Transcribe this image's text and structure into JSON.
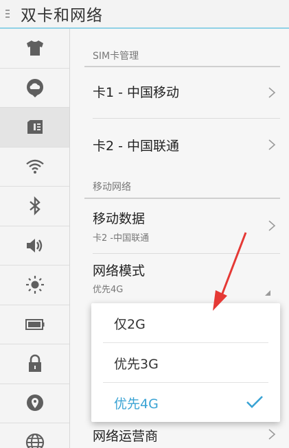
{
  "title": "双卡和网络",
  "sidebar": {
    "items": [
      {
        "icon": "shirt-icon"
      },
      {
        "icon": "cloud-icon"
      },
      {
        "icon": "sim-card-icon",
        "active": true
      },
      {
        "icon": "wifi-icon"
      },
      {
        "icon": "bluetooth-icon"
      },
      {
        "icon": "volume-icon"
      },
      {
        "icon": "brightness-icon"
      },
      {
        "icon": "battery-icon"
      },
      {
        "icon": "lock-icon"
      },
      {
        "icon": "location-icon"
      },
      {
        "icon": "globe-icon"
      }
    ]
  },
  "sim_section": {
    "header": "SIM卡管理",
    "card1": "卡1 - 中国移动",
    "card2": "卡2 - 中国联通"
  },
  "mobile_section": {
    "header": "移动网络",
    "mobile_data": {
      "title": "移动数据",
      "subtitle": "卡2 -中国联通"
    },
    "network_mode": {
      "title": "网络模式",
      "subtitle": "优先4G"
    },
    "operator": {
      "title": "网络运营商"
    }
  },
  "dropdown": {
    "options": [
      "仅2G",
      "优先3G",
      "优先4G"
    ],
    "selected": "优先4G"
  },
  "colors": {
    "accent": "#3aa3d4",
    "arrow": "#e53935",
    "title_underline": "#8fd1e6"
  }
}
